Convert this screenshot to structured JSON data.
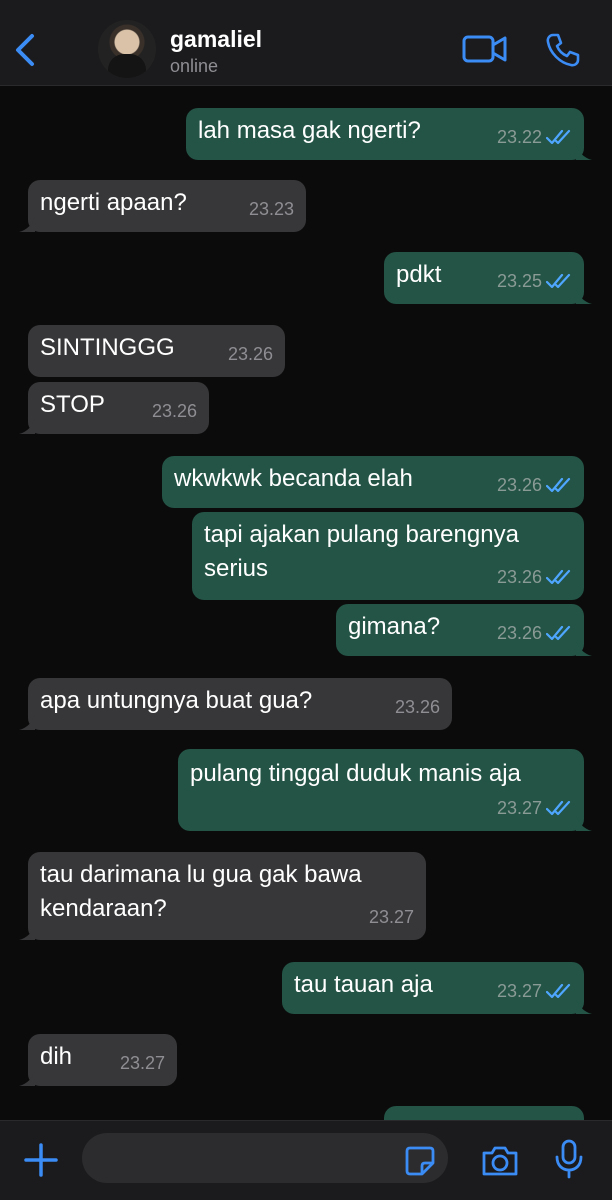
{
  "header": {
    "contact_name": "gamaliel",
    "contact_status": "online",
    "icons": {
      "back": "chevron-left-icon",
      "video": "video-camera-icon",
      "call": "phone-icon"
    }
  },
  "messages": [
    {
      "direction": "out",
      "text": "lah masa gak ngerti?",
      "time": "23.22",
      "read": true
    },
    {
      "direction": "in",
      "text": "ngerti apaan?",
      "time": "23.23"
    },
    {
      "direction": "out",
      "text": "pdkt",
      "time": "23.25",
      "read": true
    },
    {
      "direction": "in",
      "text": "SINTINGGG",
      "time": "23.26"
    },
    {
      "direction": "in",
      "text": "STOP",
      "time": "23.26"
    },
    {
      "direction": "out",
      "text": "wkwkwk becanda elah",
      "time": "23.26",
      "read": true
    },
    {
      "direction": "out",
      "text": "tapi ajakan pulang barengnya serius",
      "time": "23.26",
      "read": true
    },
    {
      "direction": "out",
      "text": "gimana?",
      "time": "23.26",
      "read": true
    },
    {
      "direction": "in",
      "text": "apa untungnya buat gua?",
      "time": "23.26"
    },
    {
      "direction": "out",
      "text": "pulang tinggal duduk manis aja",
      "time": "23.27",
      "read": true
    },
    {
      "direction": "in",
      "text": "tau darimana lu gua gak bawa kendaraan?",
      "time": "23.27"
    },
    {
      "direction": "out",
      "text": "tau tauan aja",
      "time": "23.27",
      "read": true
    },
    {
      "direction": "in",
      "text": "dih",
      "time": "23.27"
    }
  ],
  "input_bar": {
    "message_placeholder": "",
    "icons": {
      "plus": "plus-icon",
      "sticker": "sticker-icon",
      "camera": "camera-icon",
      "mic": "microphone-icon"
    }
  },
  "colors": {
    "accent": "#3b8cf5",
    "outgoing_bubble": "#235446",
    "incoming_bubble": "#373739",
    "read_ticks": "#4fa6ff",
    "background": "#0b0b0b"
  }
}
